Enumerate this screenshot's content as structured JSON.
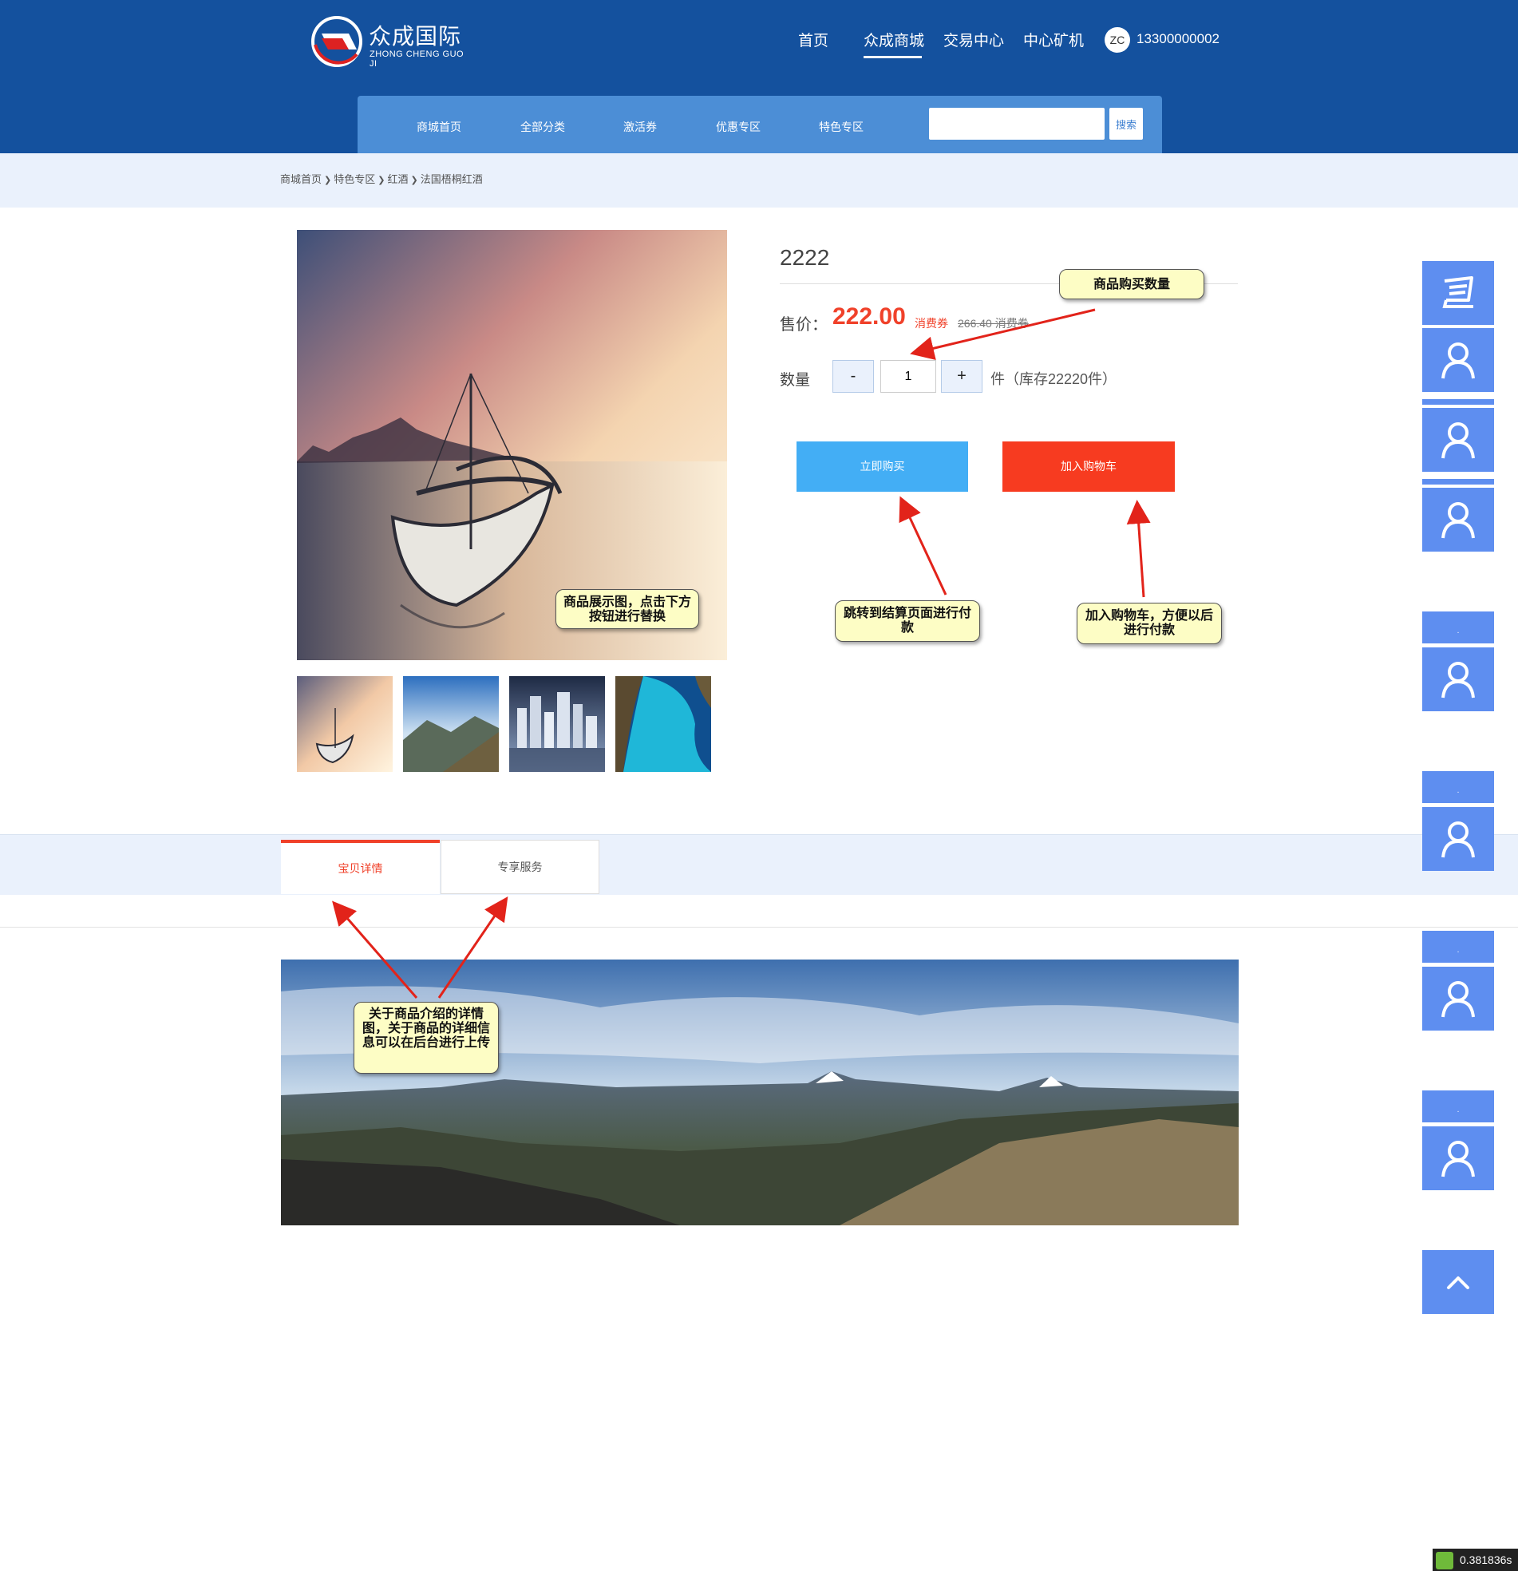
{
  "header": {
    "logo": {
      "name": "众成国际",
      "sub": "ZHONG CHENG GUO JI"
    },
    "nav": [
      "首页",
      "众成商城",
      "交易中心",
      "中心矿机"
    ],
    "user": {
      "avatar_initials": "ZC",
      "phone": "13300000002"
    }
  },
  "mall_nav": {
    "items": [
      "商城首页",
      "全部分类",
      "激活券",
      "优惠专区",
      "特色专区"
    ],
    "search_placeholder": "",
    "search_button": "搜索"
  },
  "breadcrumb": [
    "商城首页",
    "特色专区",
    "红酒",
    "法国梧桐红酒"
  ],
  "product": {
    "name": "2222",
    "price_label": "售价：",
    "price": "222.00",
    "price_unit": "消费券",
    "original_price": "266.40 消费券",
    "quantity_label": "数量",
    "minus": "-",
    "plus": "+",
    "quantity": "1",
    "stock": "件（库存22220件）",
    "buy_now": "立即购买",
    "add_to_cart": "加入购物车"
  },
  "tabs": [
    "宝贝详情",
    "专享服务"
  ],
  "callouts": {
    "image_note": "商品展示图，点击下方按钮进行替换",
    "quantity_note": "商品购买数量",
    "checkout_note": "跳转到结算页面进行付款",
    "cart_note": "加入购物车，方便以后进行付款",
    "detail_note": "关于商品介绍的详情图，关于商品的详细信息可以在后台进行上传"
  },
  "sidebar": {
    "icons": [
      "cart-icon",
      "user-icon",
      "user-icon",
      "user-icon",
      "user-icon",
      "user-icon",
      "user-icon",
      "user-icon"
    ],
    "tab_labels": [
      ".",
      ".",
      ".",
      "."
    ],
    "back_to_top": "back-to-top-icon"
  },
  "colors": {
    "header_bg": "#14519e",
    "mall_bar": "#4c8ed6",
    "accent_red": "#f0412a",
    "buy_blue": "#43aef5",
    "cart_red": "#f73b20",
    "sidebar_blue": "#5e8ef0",
    "callout_bg": "#fdfdc5"
  },
  "debug_timer": "0.381836s"
}
